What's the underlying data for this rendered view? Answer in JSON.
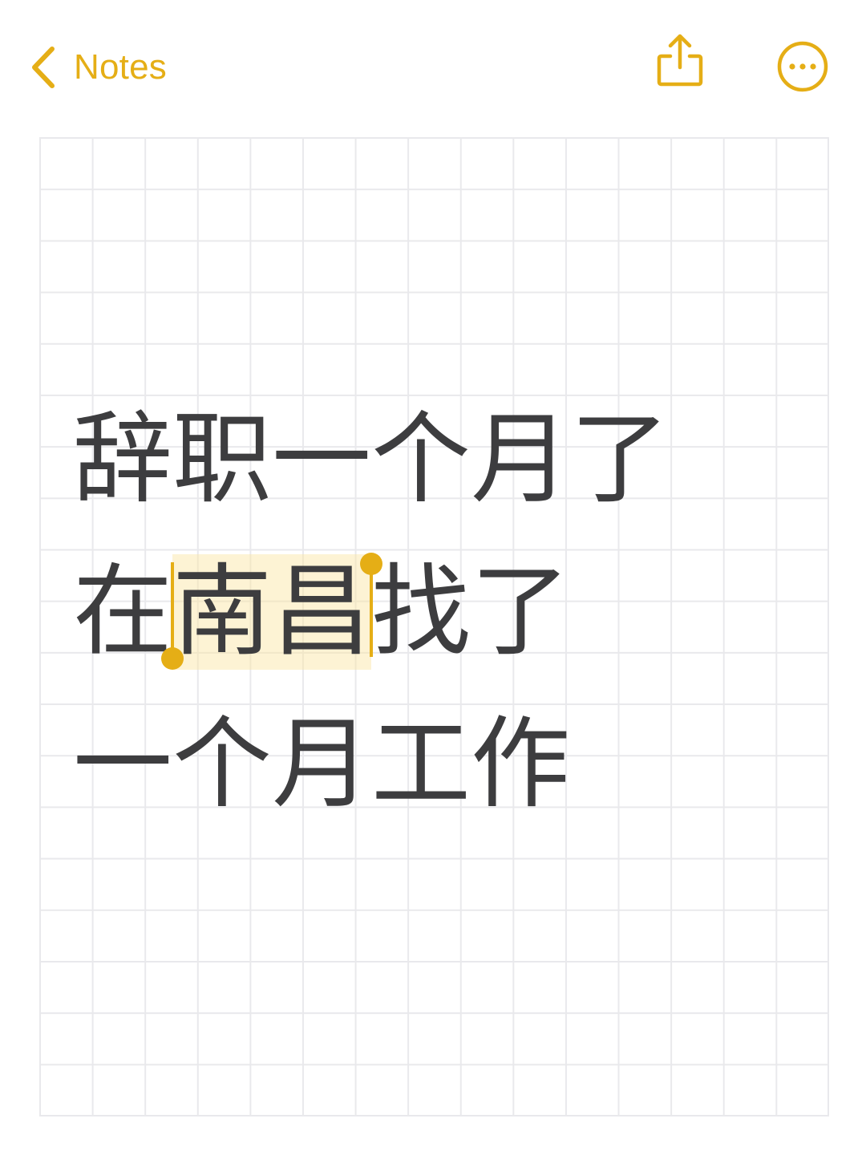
{
  "navigation": {
    "back_label": "Notes",
    "back_icon": "chevron-left-icon",
    "share_icon": "share-icon",
    "more_icon": "ellipsis-circle-icon"
  },
  "note": {
    "line1": "辞职一个月了",
    "line2_before": "在",
    "line2_selected": "南昌",
    "line2_after": "找了",
    "line3": "一个月工作"
  },
  "colors": {
    "accent": "#E5AE16",
    "text": "#3D3D3F",
    "grid": "#E9E9EC",
    "selection": "#FAE4A0"
  }
}
